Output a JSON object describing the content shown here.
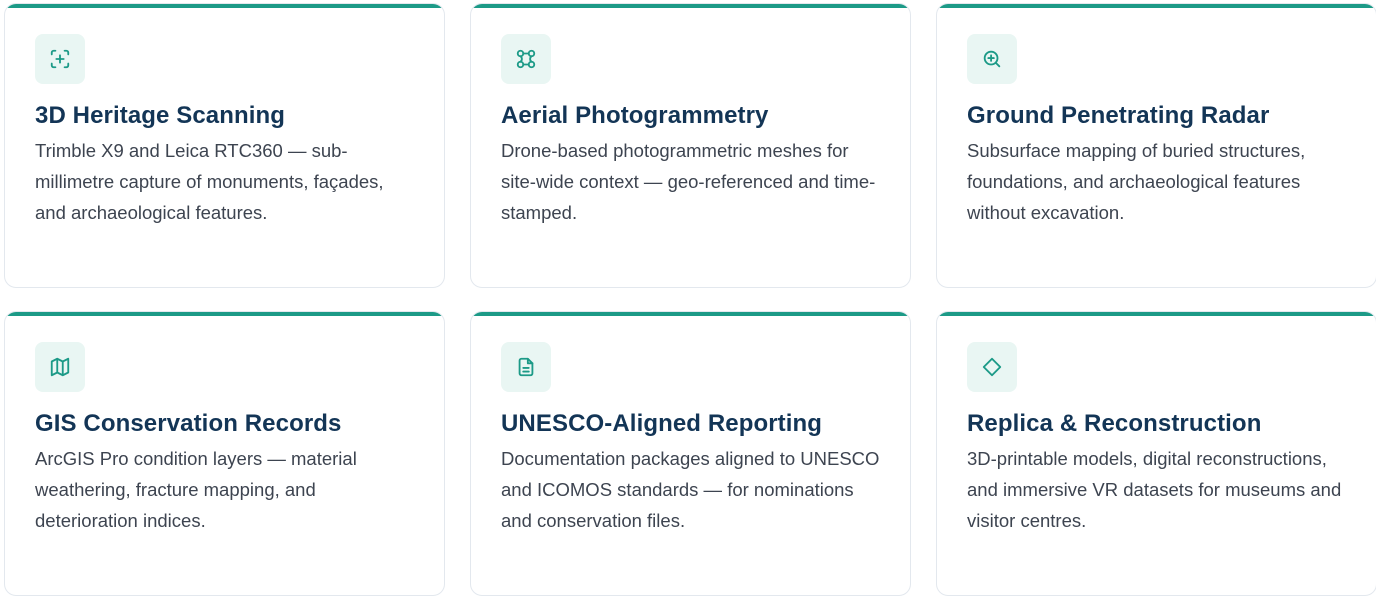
{
  "colors": {
    "accent": "#1c9a87",
    "icon_bg": "#e9f6f3",
    "title": "#133556",
    "text": "#3d4450",
    "border": "#e3e8ee"
  },
  "services": [
    {
      "icon": "scan-icon",
      "title": "3D Heritage Scanning",
      "description": "Trimble X9 and Leica RTC360 — sub-millimetre capture of monuments, façades, and archaeological features."
    },
    {
      "icon": "nodes-icon",
      "title": "Aerial Photogrammetry",
      "description": "Drone-based photogrammetric meshes for site-wide context — geo-referenced and time-stamped."
    },
    {
      "icon": "zoom-in-icon",
      "title": "Ground Penetrating Radar",
      "description": "Subsurface mapping of buried structures, foundations, and archaeological features without excavation."
    },
    {
      "icon": "map-icon",
      "title": "GIS Conservation Records",
      "description": "ArcGIS Pro condition layers — material weathering, fracture mapping, and deterioration indices."
    },
    {
      "icon": "document-icon",
      "title": "UNESCO-Aligned Reporting",
      "description": "Documentation packages aligned to UNESCO and ICOMOS standards — for nominations and conservation files."
    },
    {
      "icon": "diamond-icon",
      "title": "Replica & Reconstruction",
      "description": "3D-printable models, digital reconstructions, and immersive VR datasets for museums and visitor centres."
    }
  ]
}
